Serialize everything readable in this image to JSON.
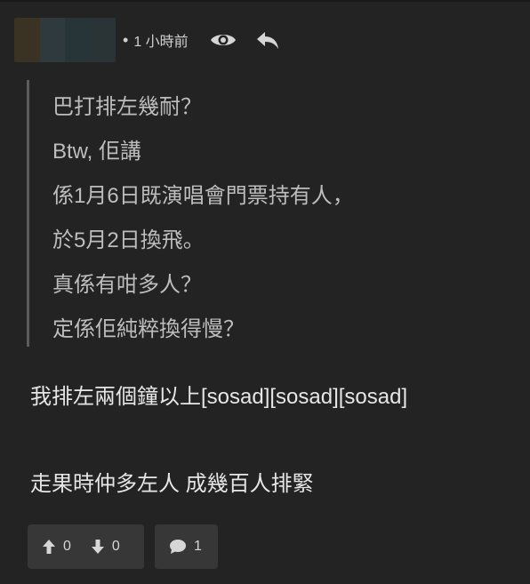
{
  "post_header": {
    "bullet": "•",
    "time_ago": "1 小時前",
    "eye_icon": "eye-icon",
    "reply_icon": "reply-arrow-icon",
    "avatar_colors": [
      "#3a3222",
      "#2f3a3e",
      "#283538"
    ]
  },
  "quote": {
    "lines": [
      "巴打排左幾耐？",
      "Btw, 佢講",
      "係1月6日既演唱會門票持有人，",
      "於5月2日換飛。",
      "真係有咁多人？",
      "定係佢純粹換得慢？"
    ]
  },
  "body": {
    "lines": [
      "我排左兩個鐘以上[sosad][sosad][sosad]",
      "走果時仲多左人 成幾百人排緊"
    ]
  },
  "actions": {
    "upvotes": "0",
    "downvotes": "0",
    "comments": "1",
    "upvote_icon": "upvote-arrow-icon",
    "downvote_icon": "downvote-arrow-icon",
    "comment_icon": "comment-bubble-icon"
  }
}
